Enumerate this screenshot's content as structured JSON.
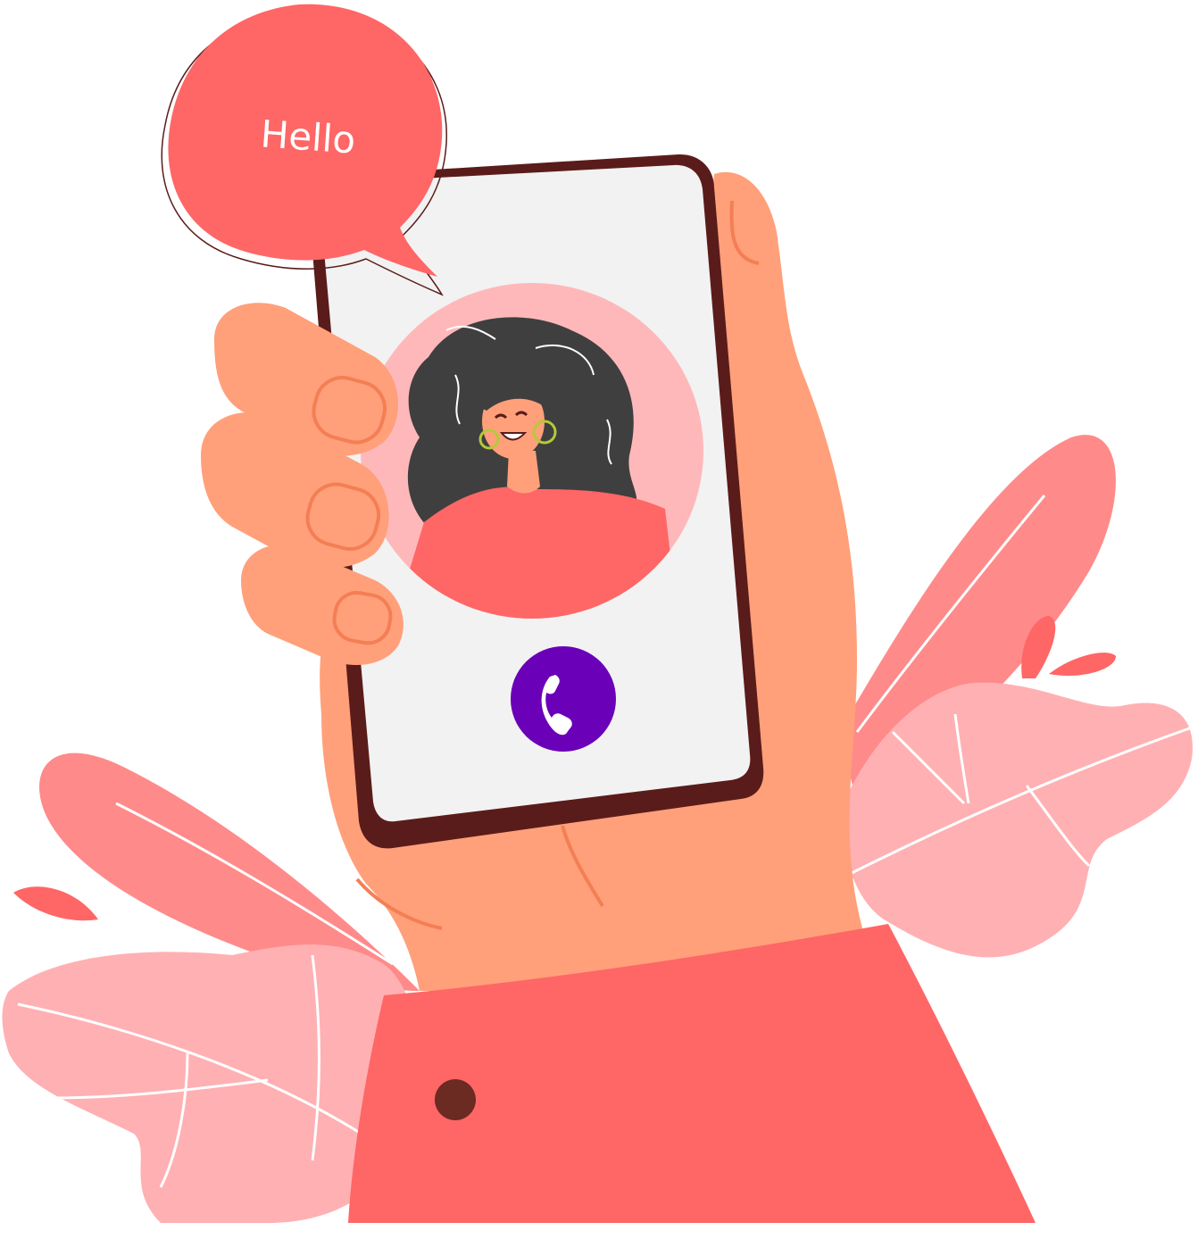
{
  "speech_bubble": {
    "text": "Hello"
  },
  "call_screen": {
    "call_button_icon": "phone-icon",
    "contact_avatar": "woman-avatar"
  },
  "colors": {
    "coral": "#FF6666",
    "leaf_dark": "#FF8A8A",
    "leaf_light": "#FFB0B3",
    "skin": "#FFA07A",
    "skin_line": "#F47E55",
    "phone_frame": "#5A1C1A",
    "screen": "#F2F2F2",
    "avatar_bg": "#FFB8BA",
    "hair": "#3F3F3F",
    "call_button": "#6A00B8",
    "button_dot": "#6B2A22"
  }
}
